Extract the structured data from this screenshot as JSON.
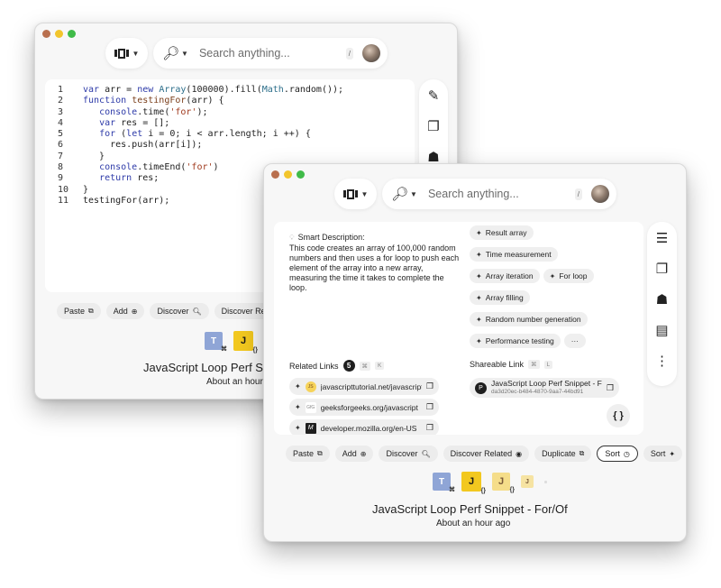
{
  "search": {
    "placeholder": "Search anything...",
    "shortcut": "/"
  },
  "back_window": {
    "code_lines": [
      {
        "n": "1",
        "html": "<span class=\"kw\">var</span> arr = <span class=\"kw\">new</span> <span class=\"cls\">Array</span>(100000).fill(<span class=\"cls\">Math</span>.random());"
      },
      {
        "n": "2",
        "html": "<span class=\"kw\">function</span> <span class=\"fn\">testingFor</span>(arr) {"
      },
      {
        "n": "3",
        "html": "   <span class=\"kw\">console</span>.time(<span class=\"str\">'for'</span>);"
      },
      {
        "n": "4",
        "html": "   <span class=\"kw\">var</span> res = [];"
      },
      {
        "n": "5",
        "html": "   <span class=\"kw\">for</span> (<span class=\"kw\">let</span> i = 0; i &lt; arr.length; i ++) {"
      },
      {
        "n": "6",
        "html": "     res.push(arr[i]);"
      },
      {
        "n": "7",
        "html": "   }"
      },
      {
        "n": "8",
        "html": "   <span class=\"kw\">console</span>.timeEnd(<span class=\"str\">'for'</span>)"
      },
      {
        "n": "9",
        "html": "   <span class=\"kw\">return</span> res;"
      },
      {
        "n": "10",
        "html": "}"
      },
      {
        "n": "11",
        "html": "testingFor(arr);"
      }
    ],
    "actions": [
      "Paste",
      "Add",
      "Discover",
      "Discover Related"
    ],
    "title": "JavaScript Loop Perf Snippet - For/Of",
    "subtitle": "About an hour ago",
    "rail_icons": [
      "pencil-icon",
      "copy-icon",
      "person-icon"
    ]
  },
  "front_window": {
    "description_label": "Smart Description:",
    "description": "This code creates an array of 100,000 random numbers and then uses a for loop to push each element of the array into a new array, measuring the time it takes to complete the loop.",
    "tags": [
      "Result array",
      "Time measurement",
      "Array iteration",
      "For loop",
      "Array filling",
      "Random number generation",
      "Performance testing"
    ],
    "more_label": "···",
    "related_links_label": "Related Links",
    "related_links_count": "5",
    "related_links_shortcut": [
      "⌘",
      "K"
    ],
    "related_links": [
      {
        "favicon": "JS",
        "text": "javascripttutorial.net/javascript"
      },
      {
        "favicon": "GfG",
        "text": "geeksforgeeks.org/javascript"
      },
      {
        "favicon": "M",
        "text": "developer.mozilla.org/en-US"
      }
    ],
    "shareable_label": "Shareable Link",
    "shareable_shortcut": [
      "⌘",
      "L"
    ],
    "shareable_title": "JavaScript Loop Perf Snippet - For/Of",
    "shareable_id": "da3d20ec-b484-4870-9aa7-44bd91",
    "actions": [
      {
        "label": "Paste",
        "icon": "⧉",
        "outlined": false
      },
      {
        "label": "Add",
        "icon": "⊕",
        "outlined": false
      },
      {
        "label": "Discover",
        "icon": "🔍︎",
        "outlined": false
      },
      {
        "label": "Discover Related",
        "icon": "◉",
        "outlined": false
      },
      {
        "label": "Duplicate",
        "icon": "⧉",
        "outlined": false
      },
      {
        "label": "Sort",
        "icon": "◷",
        "outlined": true
      },
      {
        "label": "Sort",
        "icon": "✦",
        "outlined": false
      }
    ],
    "title": "JavaScript Loop Perf Snippet - For/Of",
    "subtitle": "About an hour ago",
    "rail_icons": [
      "sliders-icon",
      "notebook-icon",
      "person-link-icon",
      "note-icon",
      "more-vertical-icon"
    ]
  }
}
